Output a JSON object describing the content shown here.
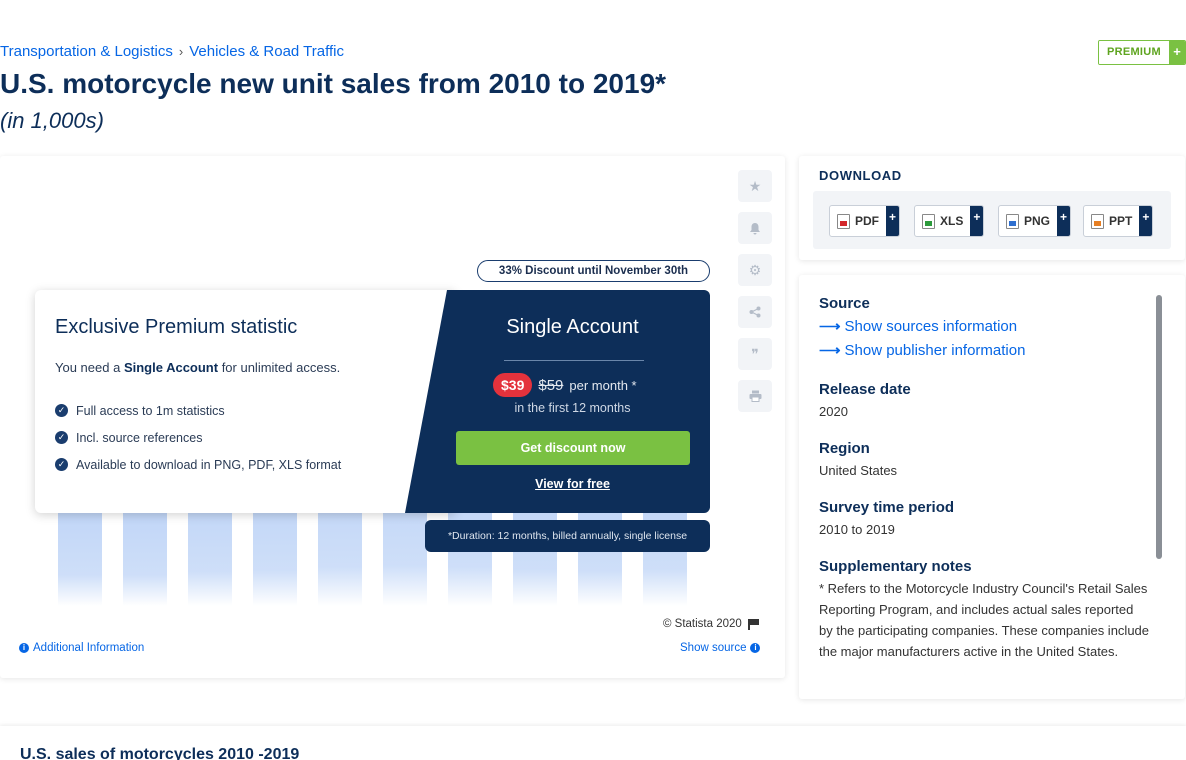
{
  "breadcrumb": {
    "items": [
      "Transportation & Logistics",
      "Vehicles & Road Traffic"
    ],
    "separator": "›"
  },
  "premium_badge": {
    "label": "PREMIUM",
    "plus": "+"
  },
  "page": {
    "title": "U.S. motorcycle new unit sales from 2010 to 2019*",
    "subtitle": "(in 1,000s)"
  },
  "chart_data": {
    "type": "bar",
    "bar_color": "#3b7de6",
    "bar_heights_visible_fraction": [
      0.0,
      0.0,
      0.0,
      0.0,
      1,
      1,
      1,
      1,
      1,
      0.0
    ],
    "values": [
      0.56,
      0.56,
      0.62,
      0.64,
      0.7,
      0.73,
      0.7,
      0.66,
      0.63,
      0.66
    ],
    "ylim": [
      0,
      1
    ],
    "note": ""
  },
  "side_tools": [
    {
      "icon": "star-icon",
      "glyph": "★"
    },
    {
      "icon": "bell-icon",
      "glyph": "🔔"
    },
    {
      "icon": "gear-icon",
      "glyph": "⚙"
    },
    {
      "icon": "share-icon",
      "glyph": "⋖"
    },
    {
      "icon": "quote-icon",
      "glyph": "❞"
    },
    {
      "icon": "print-icon",
      "glyph": "⎙"
    }
  ],
  "promo": {
    "discount_pill": "33% Discount until November 30th",
    "left_title": "Exclusive Premium statistic",
    "need_prefix": "You need a ",
    "need_bold": "Single Account",
    "need_suffix": " for unlimited access.",
    "features": [
      "Full access to 1m statistics",
      "Incl. source references",
      "Available to download in PNG, PDF, XLS format"
    ],
    "right_title": "Single Account",
    "price_new": "$39",
    "price_old": "$59",
    "per_month": "per month *",
    "first_months": "in the first 12 months",
    "cta": "Get discount now",
    "free_link": "View for free",
    "duration": "*Duration: 12 months, billed annually, single license"
  },
  "chart_footer": {
    "copyright": "© Statista 2020",
    "additional_info": "Additional Information",
    "show_source": "Show source"
  },
  "download": {
    "title": "DOWNLOAD",
    "buttons": [
      {
        "label": "PDF",
        "type": "pdf"
      },
      {
        "label": "XLS",
        "type": "xls"
      },
      {
        "label": "PNG",
        "type": "png"
      },
      {
        "label": "PPT",
        "type": "ppt"
      }
    ],
    "plus": "+"
  },
  "info": {
    "source_label": "Source",
    "show_sources": "Show sources information",
    "show_publisher": "Show publisher information",
    "release_label": "Release date",
    "release_value": "2020",
    "region_label": "Region",
    "region_value": "United States",
    "survey_label": "Survey time period",
    "survey_value": "2010 to 2019",
    "notes_label": "Supplementary notes",
    "notes_value": "* Refers to the Motorcycle Industry Council's Retail Sales Reporting Program, and includes actual sales reported by the participating companies. These companies include the major manufacturers active in the United States."
  },
  "bottom": {
    "heading": "U.S. sales of motorcycles 2010 -2019"
  }
}
